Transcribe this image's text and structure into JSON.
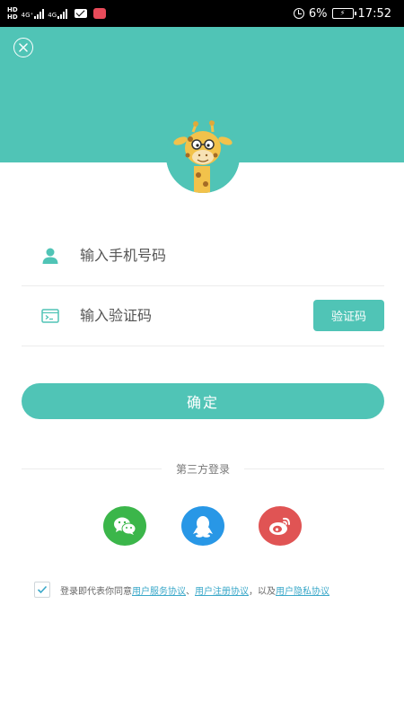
{
  "status_bar": {
    "hd1": "HD",
    "hd2": "HD",
    "net1": "4G⁺",
    "net2": "4G",
    "battery_percent": "6%",
    "time": "17:52"
  },
  "form": {
    "phone_placeholder": "输入手机号码",
    "code_placeholder": "输入验证码",
    "code_button_label": "验证码",
    "confirm_label": "确定"
  },
  "third_party": {
    "label": "第三方登录",
    "items": [
      {
        "name": "wechat",
        "icon": "wechat-icon",
        "color": "#3bb64a"
      },
      {
        "name": "qq",
        "icon": "qq-icon",
        "color": "#2897e6"
      },
      {
        "name": "weibo",
        "icon": "weibo-icon",
        "color": "#e05454"
      }
    ]
  },
  "agreement": {
    "checked": true,
    "prefix": "登录即代表你同意",
    "link_service": "用户服务协议",
    "sep": "、",
    "link_register": "用户注册协议",
    "middle": "，以及",
    "link_privacy": "用户隐私协议"
  },
  "colors": {
    "accent": "#50c4b6",
    "link": "#3aa8c9"
  }
}
